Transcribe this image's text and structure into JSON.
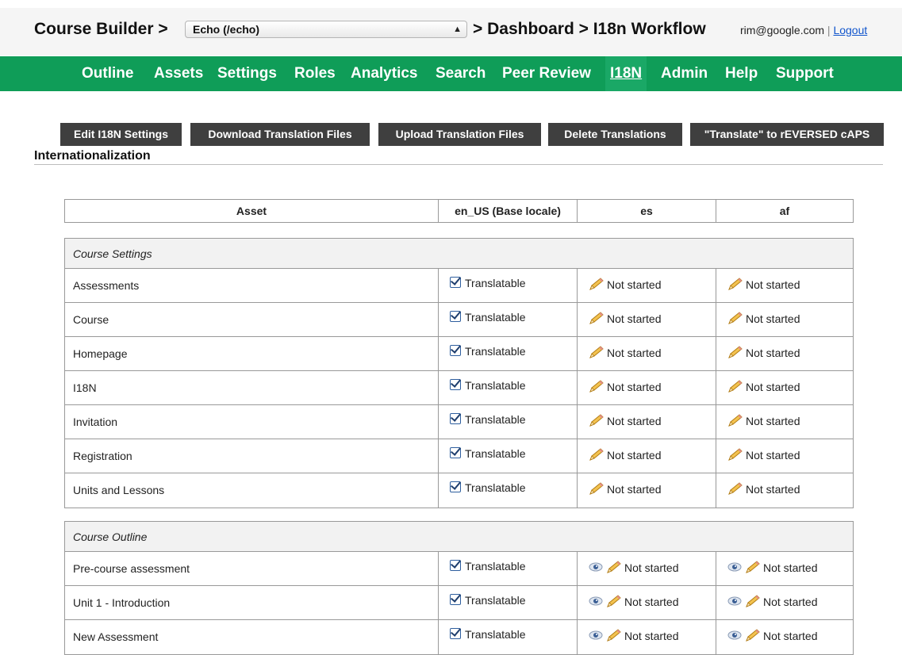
{
  "header": {
    "course_builder": "Course Builder >",
    "course_select_value": "Echo (/echo)",
    "dashboard_crumb": "> Dashboard > I18n Workflow",
    "user_email": "rim@google.com",
    "separator": "|",
    "logout": "Logout"
  },
  "nav": {
    "items": [
      "Outline",
      "Assets",
      "Settings",
      "Roles",
      "Analytics",
      "Search",
      "Peer Review",
      "I18N",
      "Admin",
      "Help",
      "Support"
    ],
    "active": "I18N",
    "color": "#0f9d58"
  },
  "toolbar": {
    "buttons": [
      "Edit I18N Settings",
      "Download Translation Files",
      "Upload Translation Files",
      "Delete Translations",
      "\"Translate\" to rEVERSED cAPS"
    ]
  },
  "section_title": "Internationalization",
  "table": {
    "headers": [
      "Asset",
      "en_US (Base locale)",
      "es",
      "af"
    ],
    "groups": [
      {
        "title": "Course Settings",
        "rows": [
          {
            "asset": "Assessments",
            "base": "Translatable",
            "es": "Not started",
            "af": "Not started"
          },
          {
            "asset": "Course",
            "base": "Translatable",
            "es": "Not started",
            "af": "Not started"
          },
          {
            "asset": "Homepage",
            "base": "Translatable",
            "es": "Not started",
            "af": "Not started"
          },
          {
            "asset": "I18N",
            "base": "Translatable",
            "es": "Not started",
            "af": "Not started"
          },
          {
            "asset": "Invitation",
            "base": "Translatable",
            "es": "Not started",
            "af": "Not started"
          },
          {
            "asset": "Registration",
            "base": "Translatable",
            "es": "Not started",
            "af": "Not started"
          },
          {
            "asset": "Units and Lessons",
            "base": "Translatable",
            "es": "Not started",
            "af": "Not started"
          }
        ]
      },
      {
        "title": "Course Outline",
        "rows": [
          {
            "asset": "Pre-course assessment",
            "base": "Translatable",
            "es": "Not started",
            "af": "Not started"
          },
          {
            "asset": "Unit 1 - Introduction",
            "base": "Translatable",
            "es": "Not started",
            "af": "Not started"
          },
          {
            "asset": "New Assessment",
            "base": "Translatable",
            "es": "Not started",
            "af": "Not started"
          }
        ]
      }
    ]
  }
}
